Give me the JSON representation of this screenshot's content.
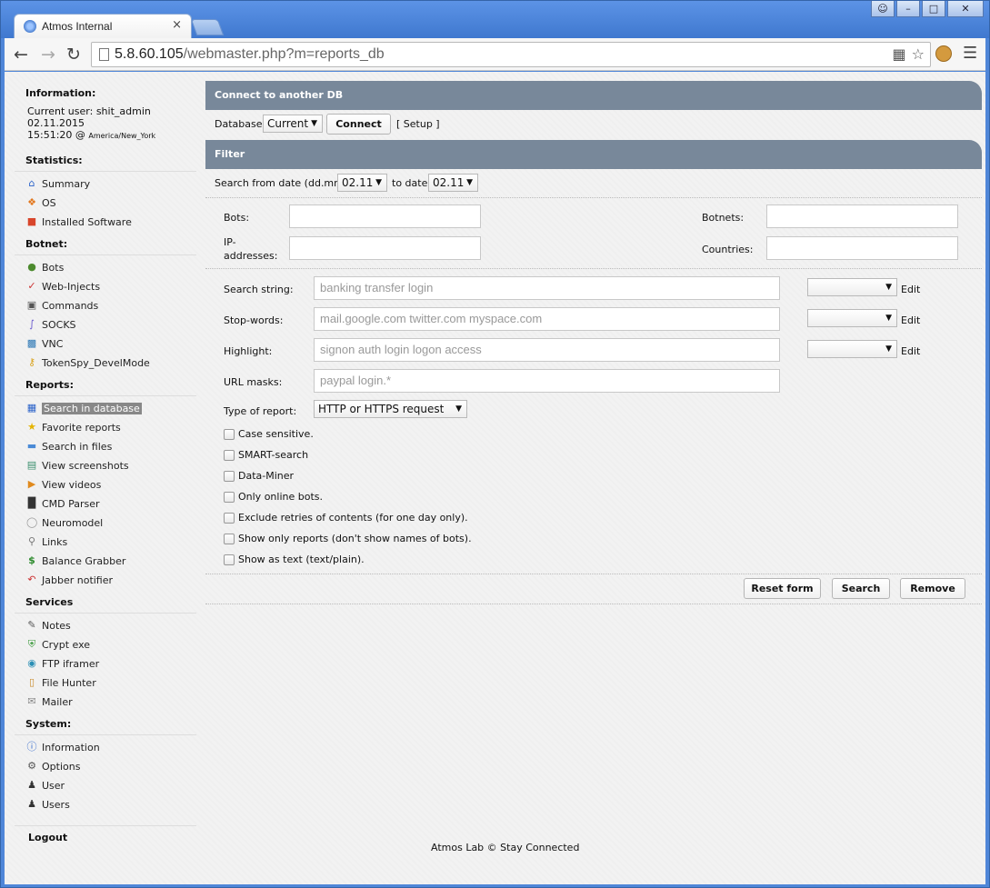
{
  "browser": {
    "tab_title": "Atmos Internal",
    "tab_close": "×",
    "url_host": "5.8.60.105",
    "url_path": "/webmaster.php?m=reports_db"
  },
  "sidebar": {
    "information_heading": "Information:",
    "current_user": "Current user: shit_admin",
    "date": "02.11.2015",
    "time": "15:51:20 @",
    "timezone": "America/New_York",
    "statistics_heading": "Statistics:",
    "statistics": [
      "Summary",
      "OS",
      "Installed Software"
    ],
    "botnet_heading": "Botnet:",
    "botnet": [
      "Bots",
      "Web-Injects",
      "Commands",
      "SOCKS",
      "VNC",
      "TokenSpy_DevelMode"
    ],
    "reports_heading": "Reports:",
    "reports": [
      "Search in database",
      "Favorite reports",
      "Search in files",
      "View screenshots",
      "View videos",
      "CMD Parser",
      "Neuromodel",
      "Links",
      "Balance Grabber",
      "Jabber notifier"
    ],
    "services_heading": "Services",
    "services": [
      "Notes",
      "Crypt exe",
      "FTP iframer",
      "File Hunter",
      "Mailer"
    ],
    "system_heading": "System:",
    "system": [
      "Information",
      "Options",
      "User",
      "Users"
    ],
    "logout": "Logout"
  },
  "connect": {
    "heading": "Connect to another DB",
    "database_label": "Database:",
    "database_value": "Current",
    "connect_button": "Connect",
    "setup_link": "[ Setup ]"
  },
  "filter": {
    "heading": "Filter",
    "search_from_label": "Search from date (dd.mm):",
    "from_value": "02.11",
    "to_label": "to date:",
    "to_value": "02.11",
    "bots_label": "Bots:",
    "botnets_label": "Botnets:",
    "ip_label_1": "IP-",
    "ip_label_2": "addresses:",
    "countries_label": "Countries:",
    "search_string_label": "Search string:",
    "search_string_placeholder": "banking transfer login",
    "stopwords_label": "Stop-words:",
    "stopwords_placeholder": "mail.google.com twitter.com myspace.com",
    "highlight_label": "Highlight:",
    "highlight_placeholder": "signon auth login logon access",
    "url_masks_label": "URL masks:",
    "url_masks_placeholder": "paypal login.*",
    "edit_label": "Edit",
    "type_label": "Type of report:",
    "type_value": "HTTP or HTTPS request",
    "checkboxes": [
      "Case sensitive.",
      "SMART-search",
      "Data-Miner",
      "Only online bots.",
      "Exclude retries of contents (for one day only).",
      "Show only reports (don't show names of bots).",
      "Show as text (text/plain)."
    ],
    "reset_button": "Reset form",
    "search_button": "Search",
    "remove_button": "Remove"
  },
  "footer": "Atmos Lab © Stay Connected"
}
